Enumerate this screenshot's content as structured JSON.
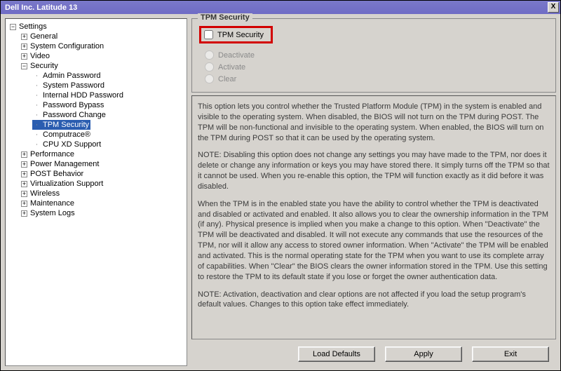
{
  "window": {
    "title": "Dell Inc. Latitude 13",
    "close_glyph": "X"
  },
  "sidebar": {
    "root": "Settings",
    "items": [
      {
        "label": "General",
        "children": []
      },
      {
        "label": "System Configuration",
        "children": []
      },
      {
        "label": "Video",
        "children": []
      },
      {
        "label": "Security",
        "expanded": true,
        "children": [
          {
            "label": "Admin Password"
          },
          {
            "label": "System Password"
          },
          {
            "label": "Internal HDD Password"
          },
          {
            "label": "Password Bypass"
          },
          {
            "label": "Password Change"
          },
          {
            "label": "TPM Security",
            "selected": true
          },
          {
            "label": "Computrace®"
          },
          {
            "label": "CPU XD Support"
          }
        ]
      },
      {
        "label": "Performance",
        "children": []
      },
      {
        "label": "Power Management",
        "children": []
      },
      {
        "label": "POST Behavior",
        "children": []
      },
      {
        "label": "Virtualization Support",
        "children": []
      },
      {
        "label": "Wireless",
        "children": []
      },
      {
        "label": "Maintenance",
        "children": []
      },
      {
        "label": "System Logs",
        "children": []
      }
    ]
  },
  "panel": {
    "group_title": "TPM Security",
    "checkbox_label": "TPM Security",
    "checkbox_checked": false,
    "radios": [
      {
        "label": "Deactivate",
        "enabled": false
      },
      {
        "label": "Activate",
        "enabled": false
      },
      {
        "label": "Clear",
        "enabled": false
      }
    ],
    "description": {
      "p1": "This option lets you control whether the Trusted Platform Module (TPM) in the system is enabled and visible to the operating system. When disabled, the BIOS will not turn on the TPM during POST. The TPM will be non-functional and invisible to the operating system. When enabled, the BIOS will turn on the TPM during POST so that it can be used by the operating system.",
      "p2": "NOTE: Disabling this option does not change any settings you may have made to the TPM, nor does it delete or change any information or keys you may have stored there. It simply turns off the TPM so that it cannot be used. When you re-enable this option, the TPM will function exactly as it did before it was disabled.",
      "p3": "When the TPM is in the enabled state you have the ability to control whether the TPM is deactivated and disabled or activated and enabled.  It also allows you to clear the ownership information in the TPM (if any). Physical presence is implied when you make a change to this option. When \"Deactivate\" the TPM will be deactivated and disabled. It will not execute any commands that use the resources of the TPM, nor will it allow any access to stored owner information. When \"Activate\" the TPM will be enabled and activated. This is the normal operating state for the TPM when you want to use its complete array of capabilities. When \"Clear\" the BIOS clears the owner information stored in the TPM. Use this setting to restore the TPM to its default state if you lose or forget the owner authentication data.",
      "p4": "NOTE: Activation, deactivation and clear options are not affected if you load the setup program's default values. Changes to this option take effect immediately."
    }
  },
  "footer": {
    "load_defaults": "Load Defaults",
    "apply": "Apply",
    "exit": "Exit"
  }
}
